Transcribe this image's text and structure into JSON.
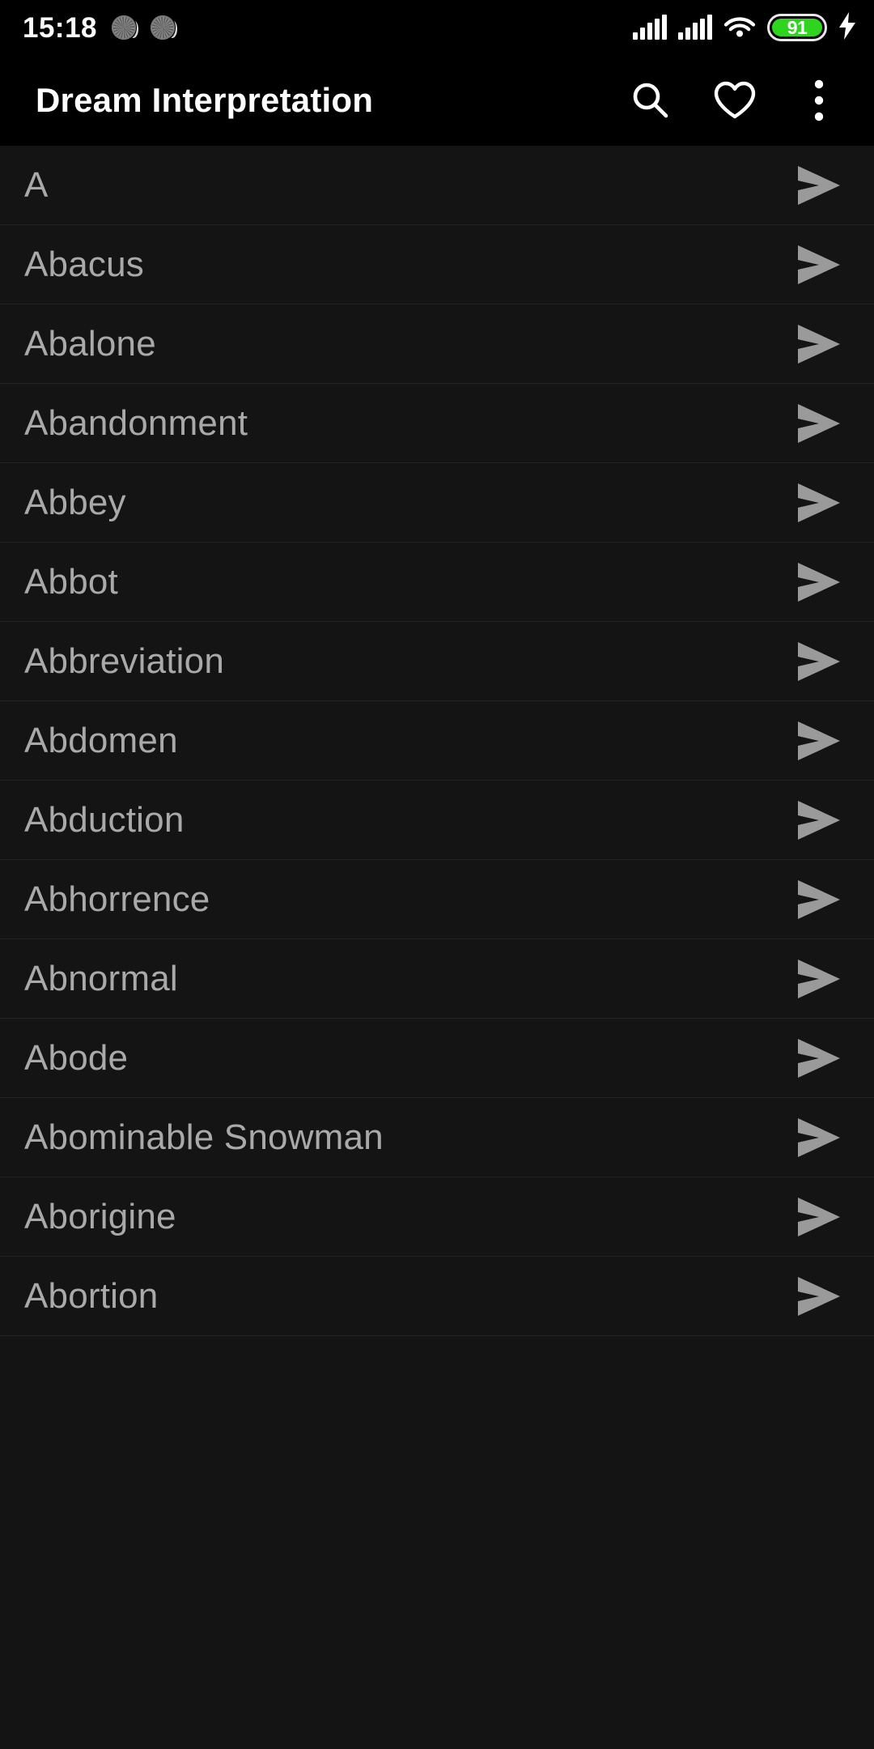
{
  "status_bar": {
    "clock": "15:18",
    "notification_icons": [
      "notification-dot-icon",
      "notification-dot-icon"
    ],
    "signal_icons": [
      "signal-bars-icon",
      "signal-bars-icon"
    ],
    "wifi_icon": "wifi-icon",
    "battery": {
      "level": "91",
      "charging_icon": "lightning-bolt-icon",
      "fill_color": "#2fd41f"
    }
  },
  "app_bar": {
    "title": "Dream Interpretation",
    "actions": [
      {
        "name": "search-button",
        "icon": "search-icon"
      },
      {
        "name": "favorites-button",
        "icon": "heart-outline-icon"
      },
      {
        "name": "overflow-button",
        "icon": "more-vertical-icon"
      }
    ]
  },
  "list": {
    "arrow_icon": "send-arrow-icon",
    "items": [
      {
        "label": "A"
      },
      {
        "label": "Abacus"
      },
      {
        "label": "Abalone"
      },
      {
        "label": "Abandonment"
      },
      {
        "label": "Abbey"
      },
      {
        "label": "Abbot"
      },
      {
        "label": "Abbreviation"
      },
      {
        "label": "Abdomen"
      },
      {
        "label": "Abduction"
      },
      {
        "label": "Abhorrence"
      },
      {
        "label": "Abnormal"
      },
      {
        "label": "Abode"
      },
      {
        "label": "Abominable Snowman"
      },
      {
        "label": "Aborigine"
      },
      {
        "label": "Abortion"
      }
    ]
  },
  "colors": {
    "background": "#000000",
    "list_background": "#141414",
    "list_text": "#a9a9a9",
    "title_text": "#ffffff",
    "divider": "#232323"
  }
}
